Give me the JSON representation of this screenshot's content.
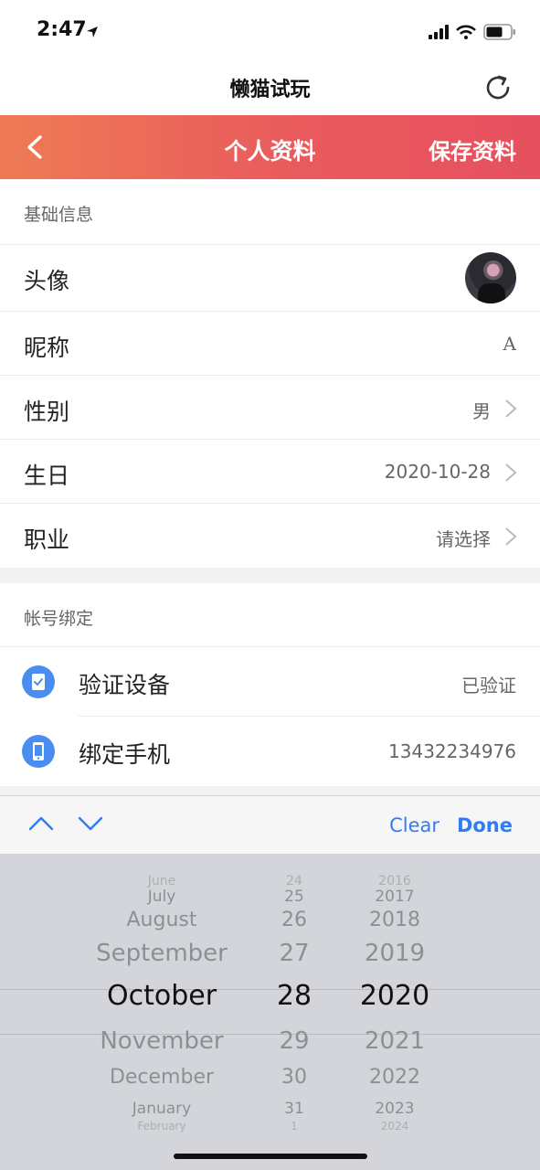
{
  "status_bar": {
    "time": "2:47"
  },
  "app": {
    "title": "懒猫试玩"
  },
  "nav": {
    "title": "个人资料",
    "save_label": "保存资料"
  },
  "basic_section": {
    "header": "基础信息",
    "rows": [
      {
        "label": "头像",
        "value": ""
      },
      {
        "label": "昵称",
        "value": "A"
      },
      {
        "label": "性别",
        "value": "男"
      },
      {
        "label": "生日",
        "value": "2020-10-28"
      },
      {
        "label": "职业",
        "value": "请选择"
      }
    ]
  },
  "account_section": {
    "header": "帐号绑定",
    "rows": [
      {
        "label": "验证设备",
        "value": "已验证",
        "icon": "verified-device-icon"
      },
      {
        "label": "绑定手机",
        "value": "13432234976",
        "icon": "phone-icon"
      }
    ]
  },
  "toolbar": {
    "clear_label": "Clear",
    "done_label": "Done"
  },
  "picker": {
    "months": [
      "June",
      "July",
      "August",
      "September",
      "October",
      "November",
      "December",
      "January",
      "February"
    ],
    "days": [
      "24",
      "25",
      "26",
      "27",
      "28",
      "29",
      "30",
      "31",
      "1"
    ],
    "years": [
      "2016",
      "2017",
      "2018",
      "2019",
      "2020",
      "2021",
      "2022",
      "2023",
      "2024"
    ],
    "selected": {
      "month": "October",
      "day": "28",
      "year": "2020"
    }
  },
  "colors": {
    "accent_start": "#ee7b55",
    "accent_end": "#e6505f",
    "link_blue": "#2f7cf6",
    "icon_blue": "#4a8df0"
  }
}
